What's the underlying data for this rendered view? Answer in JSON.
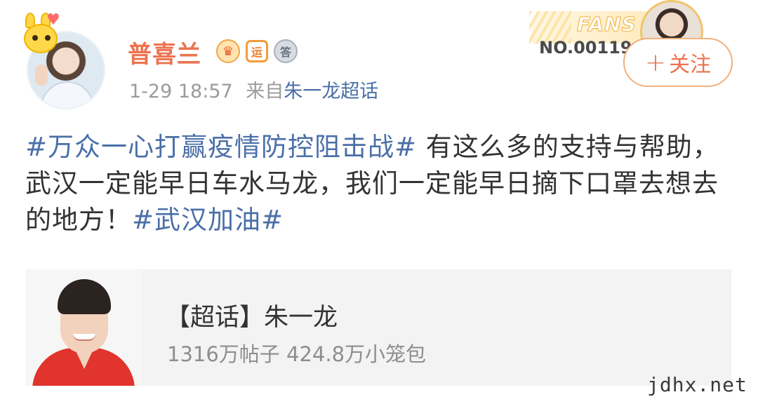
{
  "user": {
    "name": "普喜兰",
    "badges": [
      "crown-badge",
      "运",
      "答"
    ]
  },
  "meta": {
    "time": "1-29 18:57",
    "source_prefix": "来自",
    "source": "朱一龙超话"
  },
  "fans_card": {
    "label": "FANS",
    "number": "NO.001194"
  },
  "follow": {
    "plus": "+",
    "label": "关注"
  },
  "post": {
    "tag1": "#万众一心打赢疫情防控阻击战#",
    "text": " 有这么多的支持与帮助，武汉一定能早日车水马龙，我们一定能早日摘下口罩去想去的地方！",
    "tag2": "#武汉加油#"
  },
  "supertopic_card": {
    "title": "【超话】朱一龙",
    "stats": "1316万帖子 424.8万小笼包"
  },
  "watermark": "jdhx.net",
  "colors": {
    "username": "#eb7350",
    "link": "#4a6fa8",
    "text": "#333333",
    "meta": "#9b9b9b"
  }
}
